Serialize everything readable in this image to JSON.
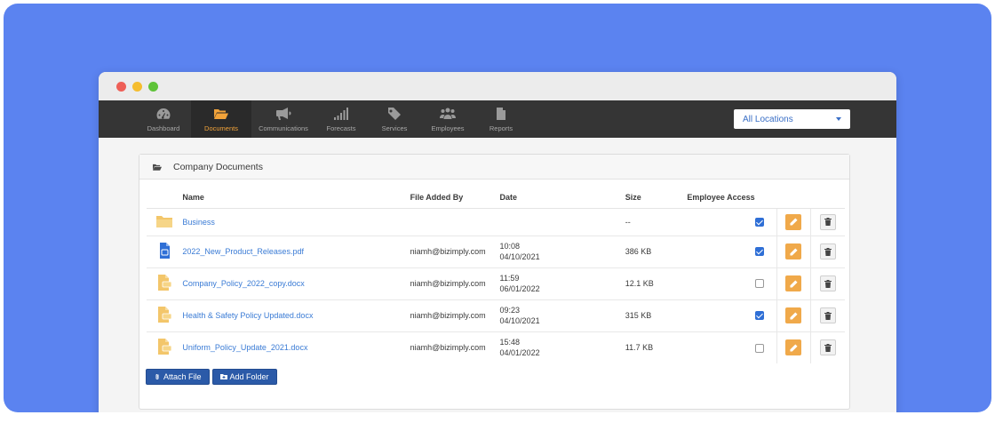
{
  "nav": {
    "items": [
      {
        "label": "Dashboard",
        "icon": "dashboard-icon"
      },
      {
        "label": "Documents",
        "icon": "folder-open-icon",
        "active": true
      },
      {
        "label": "Communications",
        "icon": "megaphone-icon"
      },
      {
        "label": "Forecasts",
        "icon": "signal-bars-icon"
      },
      {
        "label": "Services",
        "icon": "tag-icon"
      },
      {
        "label": "Employees",
        "icon": "users-icon"
      },
      {
        "label": "Reports",
        "icon": "document-icon"
      }
    ],
    "location_select": "All Locations"
  },
  "panel": {
    "title": "Company Documents"
  },
  "table": {
    "headers": [
      "Name",
      "File Added By",
      "Date",
      "Size",
      "Employee Access"
    ],
    "rows": [
      {
        "type": "folder",
        "icon": "folder-icon",
        "name": "Business",
        "added_by": "",
        "time": "",
        "date": "",
        "size": "--",
        "access": true
      },
      {
        "type": "pdf",
        "icon": "pdf-file-icon",
        "name": "2022_New_Product_Releases.pdf",
        "added_by": "niamh@bizimply.com",
        "time": "10:08",
        "date": "04/10/2021",
        "size": "386 KB",
        "access": true
      },
      {
        "type": "docx",
        "icon": "docx-file-icon",
        "name": "Company_Policy_2022_copy.docx",
        "added_by": "niamh@bizimply.com",
        "time": "11:59",
        "date": "06/01/2022",
        "size": "12.1 KB",
        "access": false
      },
      {
        "type": "docx",
        "icon": "docx-file-icon",
        "name": "Health & Safety Policy Updated.docx",
        "added_by": "niamh@bizimply.com",
        "time": "09:23",
        "date": "04/10/2021",
        "size": "315 KB",
        "access": true
      },
      {
        "type": "docx",
        "icon": "docx-file-icon",
        "name": "Uniform_Policy_Update_2021.docx",
        "added_by": "niamh@bizimply.com",
        "time": "15:48",
        "date": "04/01/2022",
        "size": "11.7 KB",
        "access": false
      }
    ]
  },
  "actions": {
    "attach_file": "Attach File",
    "add_folder": "Add Folder"
  },
  "colors": {
    "background": "#5b83f0",
    "navbar": "#353535",
    "active_nav": "#f2a33a",
    "link": "#3a7bd5",
    "edit_button": "#f0a94a",
    "primary_button": "#2b5aa8"
  }
}
